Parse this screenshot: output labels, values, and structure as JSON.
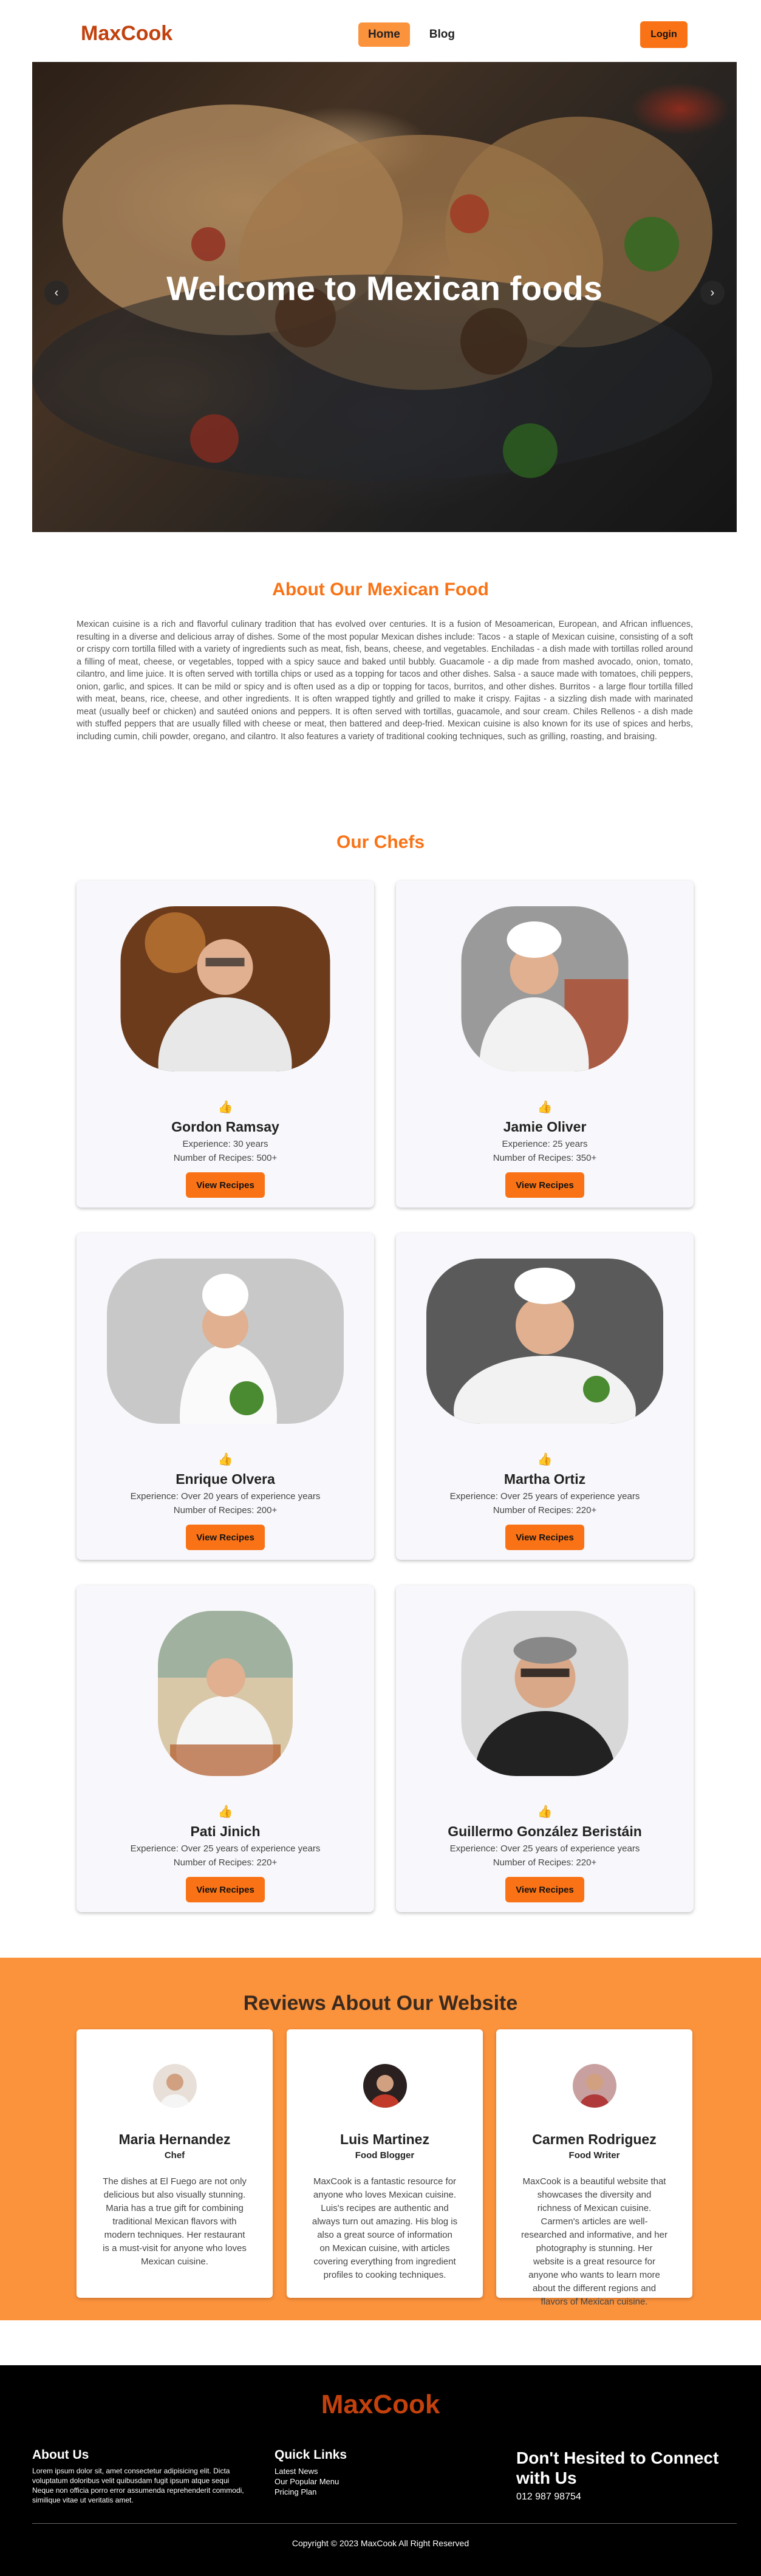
{
  "nav": {
    "logo": "MaxCook",
    "links": [
      {
        "label": "Home"
      },
      {
        "label": "Blog"
      }
    ],
    "login_label": "Login"
  },
  "hero": {
    "title": "Welcome to Mexican foods",
    "prev_icon": "‹",
    "next_icon": "›"
  },
  "about": {
    "title": "About Our Mexican Food",
    "text": "Mexican cuisine is a rich and flavorful culinary tradition that has evolved over centuries. It is a fusion of Mesoamerican, European, and African influences, resulting in a diverse and delicious array of dishes. Some of the most popular Mexican dishes include: Tacos - a staple of Mexican cuisine, consisting of a soft or crispy corn tortilla filled with a variety of ingredients such as meat, fish, beans, cheese, and vegetables. Enchiladas - a dish made with tortillas rolled around a filling of meat, cheese, or vegetables, topped with a spicy sauce and baked until bubbly. Guacamole - a dip made from mashed avocado, onion, tomato, cilantro, and lime juice. It is often served with tortilla chips or used as a topping for tacos and other dishes. Salsa - a sauce made with tomatoes, chili peppers, onion, garlic, and spices. It can be mild or spicy and is often used as a dip or topping for tacos, burritos, and other dishes. Burritos - a large flour tortilla filled with meat, beans, rice, cheese, and other ingredients. It is often wrapped tightly and grilled to make it crispy. Fajitas - a sizzling dish made with marinated meat (usually beef or chicken) and sautéed onions and peppers. It is often served with tortillas, guacamole, and sour cream. Chiles Rellenos - a dish made with stuffed peppers that are usually filled with cheese or meat, then battered and deep-fried. Mexican cuisine is also known for its use of spices and herbs, including cumin, chili powder, oregano, and cilantro. It also features a variety of traditional cooking techniques, such as grilling, roasting, and braising."
  },
  "chefs": {
    "title": "Our Chefs",
    "button_label": "View Recipes",
    "like_icon": "thumbs-up-icon",
    "items": [
      {
        "name": "Gordon Ramsay",
        "experience": "Experience: 30 years",
        "recipes": "Number of Recipes: 500+"
      },
      {
        "name": "Jamie Oliver",
        "experience": "Experience: 25 years",
        "recipes": "Number of Recipes: 350+"
      },
      {
        "name": "Enrique Olvera",
        "experience": "Experience: Over 20 years of experience years",
        "recipes": "Number of Recipes: 200+"
      },
      {
        "name": "Martha Ortiz",
        "experience": "Experience: Over 25 years of experience years",
        "recipes": "Number of Recipes: 220+"
      },
      {
        "name": "Pati Jinich",
        "experience": "Experience: Over 25 years of experience years",
        "recipes": "Number of Recipes: 220+"
      },
      {
        "name": "Guillermo González Beristáin",
        "experience": "Experience: Over 25 years of experience years",
        "recipes": "Number of Recipes: 220+"
      }
    ]
  },
  "reviews": {
    "title": "Reviews About Our Website",
    "items": [
      {
        "name": "Maria Hernandez",
        "role": "Chef",
        "text": "The dishes at El Fuego are not only delicious but also visually stunning. Maria has a true gift for combining traditional Mexican flavors with modern techniques. Her restaurant is a must-visit for anyone who loves Mexican cuisine."
      },
      {
        "name": "Luis Martinez",
        "role": "Food Blogger",
        "text": "MaxCook is a fantastic resource for anyone who loves Mexican cuisine. Luis's recipes are authentic and always turn out amazing. His blog is also a great source of information on Mexican cuisine, with articles covering everything from ingredient profiles to cooking techniques."
      },
      {
        "name": "Carmen Rodriguez",
        "role": "Food Writer",
        "text": "MaxCook is a beautiful website that showcases the diversity and richness of Mexican cuisine. Carmen's articles are well-researched and informative, and her photography is stunning. Her website is a great resource for anyone who wants to learn more about the different regions and flavors of Mexican cuisine."
      }
    ]
  },
  "footer": {
    "logo": "MaxCook",
    "about_title": "About Us",
    "about_text": "Lorem ipsum dolor sit, amet consectetur adipisicing elit. Dicta voluptatum doloribus velit quibusdam fugit ipsum atque sequi Neque non officia porro error assumenda reprehenderit commodi, similique vitae ut veritatis amet.",
    "links_title": "Quick Links",
    "links": [
      "Latest News",
      "Our Popular Menu",
      "Pricing Plan"
    ],
    "contact_title": "Don't Hesited to Connect with Us",
    "phone": "012 987 98754",
    "copyright": "Copyright © 2023 MaxCook All Right Reserved"
  },
  "colors": {
    "accent": "#f97316",
    "accent_light": "#fb923c",
    "logo": "#c2410c",
    "footer_bg": "#000000"
  }
}
